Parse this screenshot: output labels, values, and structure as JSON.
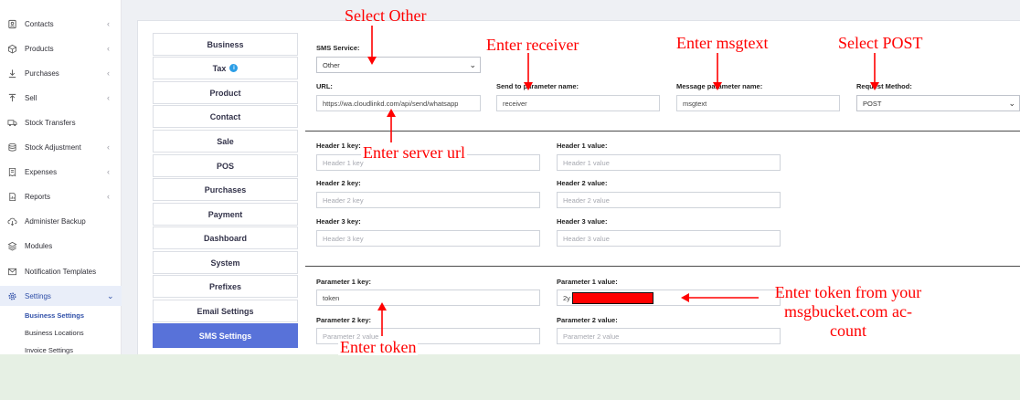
{
  "sidebar": {
    "items": [
      {
        "label": "Contacts",
        "icon": "contacts-icon"
      },
      {
        "label": "Products",
        "icon": "box-icon"
      },
      {
        "label": "Purchases",
        "icon": "download-arrow-icon"
      },
      {
        "label": "Sell",
        "icon": "upload-arrow-icon"
      },
      {
        "label": "Stock Transfers",
        "icon": "truck-icon"
      },
      {
        "label": "Stock Adjustment",
        "icon": "database-icon"
      },
      {
        "label": "Expenses",
        "icon": "receipt-icon"
      },
      {
        "label": "Reports",
        "icon": "report-icon"
      },
      {
        "label": "Administer Backup",
        "icon": "cloud-download-icon"
      },
      {
        "label": "Modules",
        "icon": "stack-icon"
      },
      {
        "label": "Notification Templates",
        "icon": "envelope-icon"
      },
      {
        "label": "Settings",
        "icon": "gear-icon"
      }
    ],
    "sub_items": [
      "Business Settings",
      "Business Locations",
      "Invoice Settings"
    ]
  },
  "tabs": [
    "Business",
    "Tax",
    "Product",
    "Contact",
    "Sale",
    "POS",
    "Purchases",
    "Payment",
    "Dashboard",
    "System",
    "Prefixes",
    "Email Settings",
    "SMS Settings"
  ],
  "form": {
    "sms_service_label": "SMS Service:",
    "sms_service_value": "Other",
    "url_label": "URL:",
    "url_value": "https://wa.cloudlinkd.com/api/send/whatsapp",
    "send_to_label": "Send to parameter name:",
    "send_to_value": "receiver",
    "message_label": "Message parameter name:",
    "message_value": "msgtext",
    "method_label": "Request Method:",
    "method_value": "POST",
    "header1_key_label": "Header 1 key:",
    "header1_key_placeholder": "Header 1 key",
    "header1_value_label": "Header 1 value:",
    "header1_value_placeholder": "Header 1 value",
    "header2_key_label": "Header 2 key:",
    "header2_key_placeholder": "Header 2 key",
    "header2_value_label": "Header 2 value:",
    "header2_value_placeholder": "Header 2 value",
    "header3_key_label": "Header 3 key:",
    "header3_key_placeholder": "Header 3 key",
    "header3_value_label": "Header 3 value:",
    "header3_value_placeholder": "Header 3 value",
    "param1_key_label": "Parameter 1 key:",
    "param1_key_value": "token",
    "param1_value_label": "Parameter 1 value:",
    "param1_value_text": "2y",
    "param2_key_label": "Parameter 2 key:",
    "param2_key_placeholder": "Parameter 2 value",
    "param2_value_label": "Parameter 2 value:",
    "param2_value_placeholder": "Parameter 2 value"
  },
  "annotations": {
    "select_other": "Select Other",
    "enter_receiver": "Enter receiver",
    "enter_msgtext": "Enter msgtext",
    "select_post": "Select POST",
    "enter_server_url": "Enter server url",
    "enter_token": "Enter token",
    "token_line1": "Enter token from your",
    "token_line2": "msgbucket.com ac-",
    "token_line3": "count"
  },
  "colors": {
    "annotation_red": "#ff0000",
    "active_tab": "#5872d9",
    "active_nav_bg": "#e9eef9",
    "bottom_strip": "#e6f0e4"
  }
}
